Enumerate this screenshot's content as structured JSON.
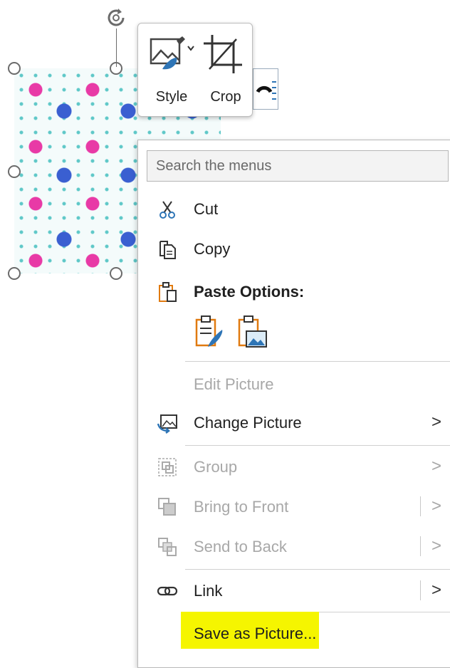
{
  "mini_toolbar": {
    "style_label": "Style",
    "crop_label": "Crop"
  },
  "context_menu": {
    "search_placeholder": "Search the menus",
    "items": {
      "cut": "Cut",
      "copy": "Copy",
      "paste_options": "Paste Options:",
      "edit_picture": "Edit Picture",
      "change_picture": "Change Picture",
      "group": "Group",
      "bring_to_front": "Bring to Front",
      "send_to_back": "Send to Back",
      "link": "Link",
      "save_as_picture": "Save as Picture..."
    },
    "submenu_glyph": ">"
  },
  "colors": {
    "highlight": "#f5f500",
    "icon_blue": "#2e75b6",
    "icon_orange": "#e07a10",
    "disabled": "#a8a8a8"
  }
}
